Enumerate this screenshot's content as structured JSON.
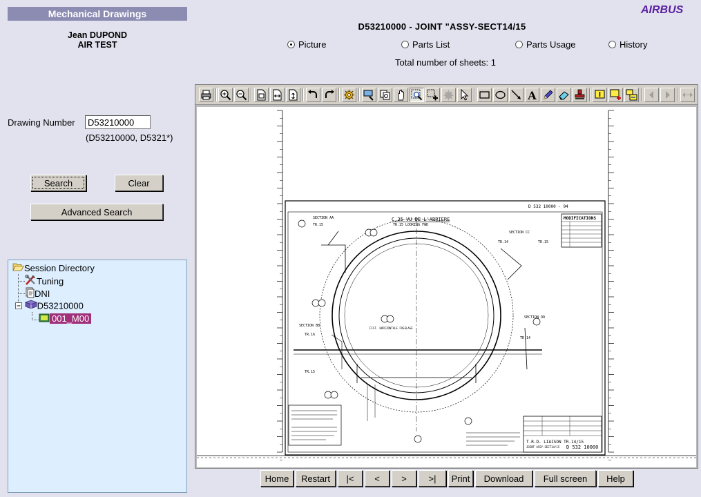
{
  "app": {
    "title": "Mechanical Drawings",
    "brand": "AIRBUS"
  },
  "user": {
    "name": "Jean DUPOND",
    "org": "AIR TEST"
  },
  "search": {
    "label": "Drawing Number",
    "value": "D53210000",
    "hint": "(D53210000, D5321*)",
    "search_label": "Search",
    "clear_label": "Clear",
    "advanced_label": "Advanced Search"
  },
  "tree": {
    "root": "Session Directory",
    "items": [
      "Tuning",
      "DNI",
      "D53210000"
    ],
    "child": "001_M00"
  },
  "header": {
    "drawing_title": "D53210000 - JOINT \"ASSY-SECT14/15",
    "sheet_count": "Total number of sheets: 1"
  },
  "tabs": [
    {
      "label": "Picture",
      "selected": true
    },
    {
      "label": "Parts List",
      "selected": false
    },
    {
      "label": "Parts Usage",
      "selected": false
    },
    {
      "label": "History",
      "selected": false
    }
  ],
  "toolbar_icons": [
    "print-icon",
    "zoom-in-icon",
    "zoom-out-icon",
    "fit-page-icon",
    "fit-width-icon",
    "fit-height-icon",
    "rotate-left-icon",
    "rotate-right-icon",
    "settings-icon",
    "zoom-window-icon",
    "magnifier-icon",
    "pan-icon",
    "zoom-box-icon",
    "zoom-plus-icon",
    "burst-icon",
    "select-arrow-icon",
    "rectangle-icon",
    "ellipse-icon",
    "line-arrow-icon",
    "text-tool-icon",
    "pen-icon",
    "eraser-icon",
    "stamp-icon",
    "note-icon",
    "note-add-icon",
    "note-list-icon",
    "prev-page-icon",
    "next-page-icon",
    "scroll-icon"
  ],
  "drawing": {
    "frame_title": "C.35 VU DE L'ARRIERE",
    "frame_subtitle": "TR.15    LOOKING FWD",
    "modifications_label": "MODIFICATIONS",
    "section_labels": [
      "SECTION AA",
      "SECTION CC",
      "SECTION BB",
      "SECTION DD"
    ],
    "frame_labels": [
      "TR.15",
      "TR.14",
      "TR.16",
      "TR.14",
      "TR.15",
      "TR.15"
    ],
    "title_block": "T.R.D. LIAISON TR.14/15",
    "title_block_sub": "JOINT ASSY-SECT14/15",
    "doc_number": "D 532 10000",
    "axis_label": "FIST. HORIZONTALE FUSELAGE",
    "top_ref": "D 532 10000 - 94"
  },
  "nav": {
    "buttons": [
      "Home",
      "Restart",
      "|<",
      "<",
      ">",
      ">|",
      "Print",
      "Download",
      "Full screen",
      "Help"
    ]
  }
}
